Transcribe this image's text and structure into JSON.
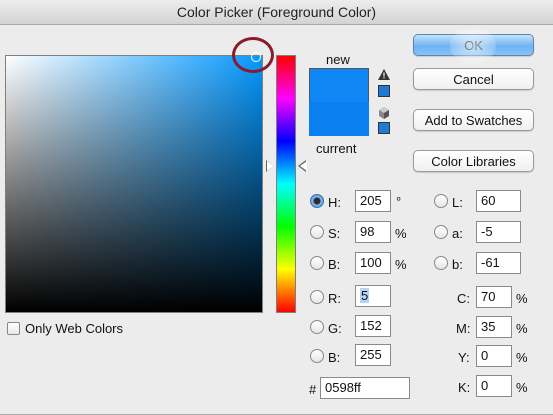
{
  "window": {
    "title": "Color Picker (Foreground Color)"
  },
  "colors": {
    "new": "#0e86f4",
    "current": "#0a7ff0",
    "hex_value": "#0598ff",
    "highlight_ring": "#8b1a2b"
  },
  "swatch": {
    "new_label": "new",
    "current_label": "current"
  },
  "buttons": {
    "ok": "OK",
    "cancel": "Cancel",
    "add_to_swatches": "Add to Swatches",
    "color_libraries": "Color Libraries"
  },
  "icons": {
    "gamut_warning": "warning-triangle-icon",
    "web_safe": "cube-icon"
  },
  "hsb": {
    "h_label": "H:",
    "h_value": "205",
    "h_unit": "°",
    "s_label": "S:",
    "s_value": "98",
    "s_unit": "%",
    "b_label": "B:",
    "b_value": "100",
    "b_unit": "%"
  },
  "lab": {
    "l_label": "L:",
    "l_value": "60",
    "a_label": "a:",
    "a_value": "-5",
    "b_label": "b:",
    "b_value": "-61"
  },
  "rgb": {
    "r_label": "R:",
    "r_value": "5",
    "g_label": "G:",
    "g_value": "152",
    "b_label": "B:",
    "b_value": "255"
  },
  "cmyk": {
    "c_label": "C:",
    "c_value": "70",
    "c_unit": "%",
    "m_label": "M:",
    "m_value": "35",
    "m_unit": "%",
    "y_label": "Y:",
    "y_value": "0",
    "y_unit": "%",
    "k_label": "K:",
    "k_value": "0",
    "k_unit": "%"
  },
  "hex": {
    "label": "#",
    "value": "0598ff"
  },
  "only_web_colors": {
    "label": "Only Web Colors",
    "checked": false
  },
  "selected_mode": "H"
}
